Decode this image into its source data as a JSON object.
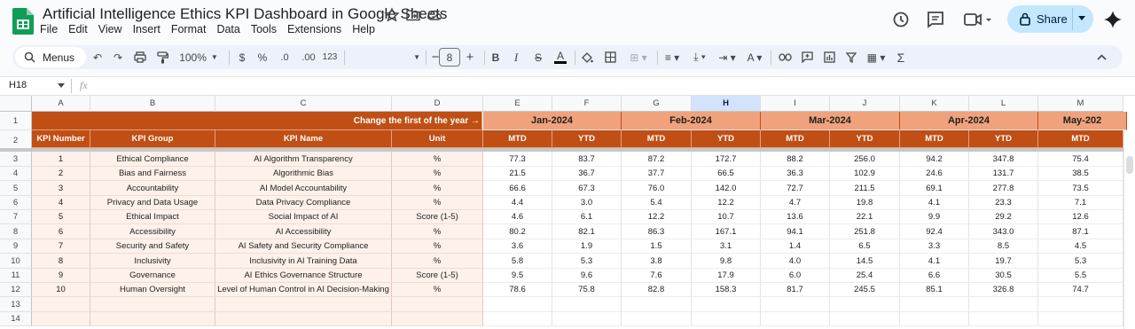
{
  "app": {
    "doc_title": "Artificial Intelligence Ethics KPI Dashboard in Google Sheets",
    "menu": [
      "File",
      "Edit",
      "View",
      "Insert",
      "Format",
      "Data",
      "Tools",
      "Extensions",
      "Help"
    ],
    "share_label": "Share",
    "accent": "#c2e7ff"
  },
  "toolbar": {
    "search_label": "Menus",
    "zoom": "100%",
    "currency": "$",
    "percent": "%",
    "dec_decrease": ".0",
    "dec_increase": ".00",
    "number_format": "123",
    "font_size": "8"
  },
  "formula": {
    "cell_ref": "H18",
    "fx": "fx",
    "value": ""
  },
  "colors": {
    "header_dark": "#c04f15",
    "header_light": "#f0a27c",
    "data_fill": "#fdf1ea"
  },
  "sheet": {
    "columns": [
      "A",
      "B",
      "C",
      "D",
      "E",
      "F",
      "G",
      "H",
      "I",
      "J",
      "K",
      "L",
      "M"
    ],
    "rows": [
      "1",
      "2",
      "3",
      "4",
      "5",
      "6",
      "7",
      "8",
      "9",
      "10",
      "11",
      "12",
      "13",
      "14"
    ],
    "row1_label": "Change the first of the year →",
    "months": [
      "Jan-2024",
      "Feb-2024",
      "Mar-2024",
      "Apr-2024",
      "May-202"
    ],
    "headers": [
      "KPI Number",
      "KPI Group",
      "KPI Name",
      "Unit"
    ],
    "period_headers": [
      "MTD",
      "YTD",
      "MTD",
      "YTD",
      "MTD",
      "YTD",
      "MTD",
      "YTD",
      "MTD"
    ],
    "kpis": [
      {
        "num": "1",
        "group": "Ethical Compliance",
        "name": "AI Algorithm Transparency",
        "unit": "%",
        "values": [
          "77.3",
          "83.7",
          "87.2",
          "172.7",
          "88.2",
          "256.0",
          "94.2",
          "347.8",
          "75.4"
        ]
      },
      {
        "num": "2",
        "group": "Bias and Fairness",
        "name": "Algorithmic Bias",
        "unit": "%",
        "values": [
          "21.5",
          "36.7",
          "37.7",
          "66.5",
          "36.3",
          "102.9",
          "24.6",
          "131.7",
          "38.5"
        ]
      },
      {
        "num": "3",
        "group": "Accountability",
        "name": "AI Model Accountability",
        "unit": "%",
        "values": [
          "66.6",
          "67.3",
          "76.0",
          "142.0",
          "72.7",
          "211.5",
          "69.1",
          "277.8",
          "73.5"
        ]
      },
      {
        "num": "4",
        "group": "Privacy and Data Usage",
        "name": "Data Privacy Compliance",
        "unit": "%",
        "values": [
          "4.4",
          "3.0",
          "5.4",
          "12.2",
          "4.7",
          "19.8",
          "4.1",
          "23.3",
          "7.1"
        ]
      },
      {
        "num": "5",
        "group": "Ethical Impact",
        "name": "Social Impact of AI",
        "unit": "Score (1-5)",
        "values": [
          "4.6",
          "6.1",
          "12.2",
          "10.7",
          "13.6",
          "22.1",
          "9.9",
          "29.2",
          "12.6"
        ]
      },
      {
        "num": "6",
        "group": "Accessibility",
        "name": "AI Accessibility",
        "unit": "%",
        "values": [
          "80.2",
          "82.1",
          "86.3",
          "167.1",
          "94.1",
          "251.8",
          "92.4",
          "343.0",
          "87.1"
        ]
      },
      {
        "num": "7",
        "group": "Security and Safety",
        "name": "AI Safety and Security Compliance",
        "unit": "%",
        "values": [
          "3.6",
          "1.9",
          "1.5",
          "3.1",
          "1.4",
          "6.5",
          "3.3",
          "8.5",
          "4.5"
        ]
      },
      {
        "num": "8",
        "group": "Inclusivity",
        "name": "Inclusivity in AI Training Data",
        "unit": "%",
        "values": [
          "5.8",
          "5.3",
          "3.8",
          "9.8",
          "4.0",
          "14.5",
          "4.1",
          "19.7",
          "5.3"
        ]
      },
      {
        "num": "9",
        "group": "Governance",
        "name": "AI Ethics Governance Structure",
        "unit": "Score (1-5)",
        "values": [
          "9.5",
          "9.6",
          "7.6",
          "17.9",
          "6.0",
          "25.4",
          "6.6",
          "30.5",
          "5.5"
        ]
      },
      {
        "num": "10",
        "group": "Human Oversight",
        "name": "Level of Human Control in AI Decision-Making",
        "unit": "%",
        "values": [
          "78.6",
          "75.8",
          "82.8",
          "158.3",
          "81.7",
          "245.5",
          "85.1",
          "326.8",
          "74.7"
        ]
      }
    ]
  }
}
